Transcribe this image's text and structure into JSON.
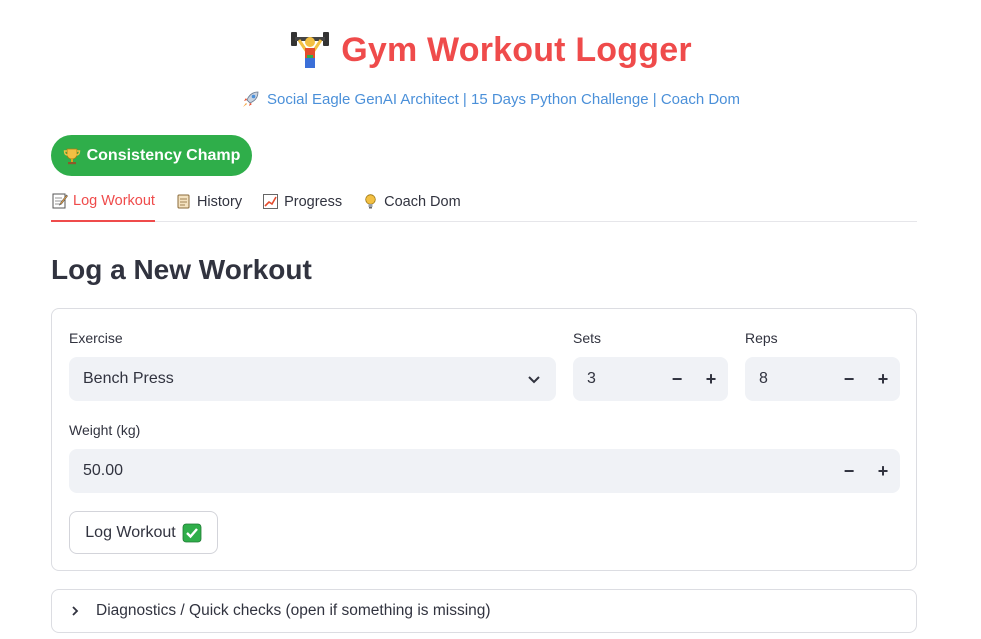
{
  "header": {
    "title": "Gym Workout Logger",
    "title_icon": "weightlifter-icon",
    "subtitle": "Social Eagle GenAI Architect | 15 Days Python Challenge | Coach Dom",
    "subtitle_icon": "rocket-icon"
  },
  "badge": {
    "label": "Consistency Champ",
    "icon": "trophy-icon"
  },
  "tabs": [
    {
      "label": "Log Workout",
      "icon": "memo-icon",
      "active": true
    },
    {
      "label": "History",
      "icon": "scroll-icon",
      "active": false
    },
    {
      "label": "Progress",
      "icon": "chart-increasing-icon",
      "active": false
    },
    {
      "label": "Coach Dom",
      "icon": "lightbulb-icon",
      "active": false
    }
  ],
  "section": {
    "title": "Log a New Workout"
  },
  "form": {
    "exercise": {
      "label": "Exercise",
      "value": "Bench Press"
    },
    "sets": {
      "label": "Sets",
      "value": "3"
    },
    "reps": {
      "label": "Reps",
      "value": "8"
    },
    "weight": {
      "label": "Weight (kg)",
      "value": "50.00"
    },
    "minus_symbol": "−",
    "plus_symbol": "+",
    "submit_label": "Log Workout"
  },
  "expander": {
    "label": "Diagnostics / Quick checks (open if something is missing)"
  },
  "colors": {
    "accent": "#ef4b4b",
    "link": "#4b90d9",
    "badge": "#2fae4a",
    "input_bg": "#f0f2f6"
  }
}
